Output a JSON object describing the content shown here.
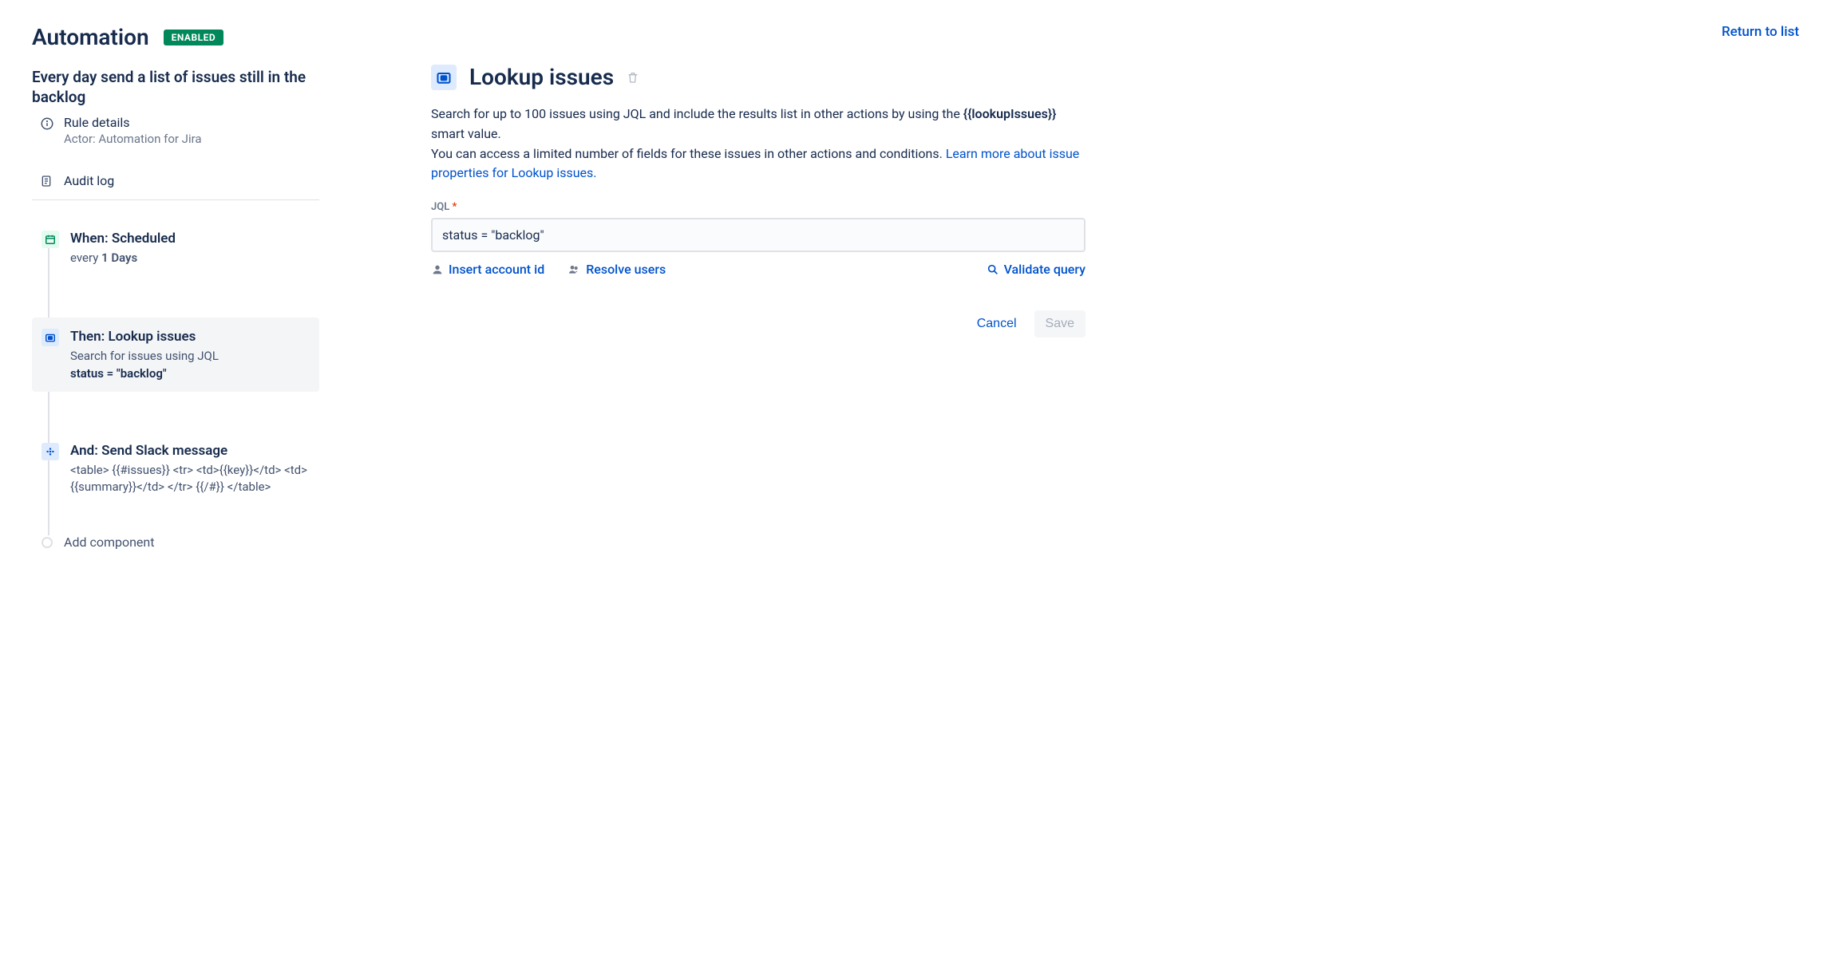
{
  "header": {
    "title": "Automation",
    "status_badge": "ENABLED",
    "return_link": "Return to list"
  },
  "rule": {
    "name": "Every day send a list of issues still in the backlog",
    "details_label": "Rule details",
    "actor_label": "Actor: Automation for Jira",
    "audit_log_label": "Audit log"
  },
  "flow": {
    "trigger": {
      "title": "When: Scheduled",
      "desc_prefix": "every ",
      "desc_bold": "1 Days"
    },
    "action1": {
      "title": "Then: Lookup issues",
      "desc": "Search for issues using JQL",
      "code": "status = \"backlog\""
    },
    "action2": {
      "title": "And: Send Slack message",
      "desc": "<table> {{#issues}} <tr> <td>{{key}}</td> <td>{{summary}}</td> </tr> {{/#}} </table>"
    },
    "add_label": "Add component"
  },
  "panel": {
    "title": "Lookup issues",
    "desc_part1": "Search for up to 100 issues using JQL and include the results list in other actions by using the ",
    "desc_bold": "{{lookupIssues}}",
    "desc_part2": " smart value.",
    "desc_part3": "You can access a limited number of fields for these issues in other actions and conditions. ",
    "learn_more": "Learn more about issue properties for Lookup issues.",
    "jql_label": "JQL",
    "jql_value": "status = \"backlog\"",
    "insert_account": "Insert account id",
    "resolve_users": "Resolve users",
    "validate_query": "Validate query",
    "cancel": "Cancel",
    "save": "Save"
  }
}
